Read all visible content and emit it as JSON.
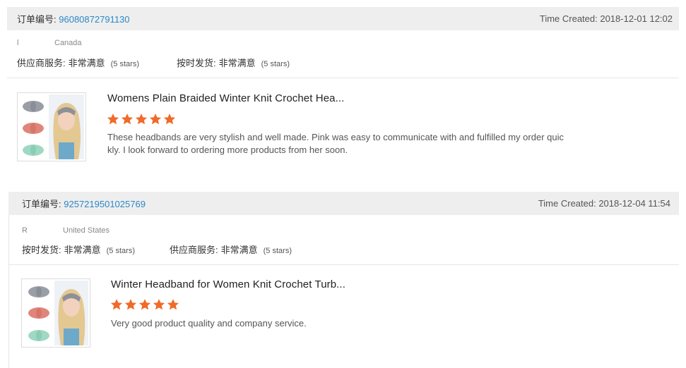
{
  "orders": [
    {
      "order_label": "订单编号:",
      "order_number": "96080872791130",
      "time_created": "Time Created: 2018-12-01 12:02",
      "buyer_initial": "l",
      "buyer_country": "Canada",
      "ratings": [
        {
          "label": "供应商服务:",
          "value": "非常满意",
          "stars_text": "(5 stars)"
        },
        {
          "label": "按时发货:",
          "value": "非常满意",
          "stars_text": "(5 stars)"
        }
      ],
      "product_title": "Womens Plain Braided Winter Knit Crochet Hea...",
      "star_rating": 5,
      "review": "These headbands are very stylish and well made. Pink was easy to communicate with and fulfilled my order quickly. I look forward to ordering more products from her soon."
    },
    {
      "order_label": "订单编号:",
      "order_number": "9257219501025769",
      "time_created": "Time Created: 2018-12-04 11:54",
      "buyer_initial": "R",
      "buyer_country": "United States",
      "ratings": [
        {
          "label": "按时发货:",
          "value": "非常满意",
          "stars_text": "(5 stars)"
        },
        {
          "label": "供应商服务:",
          "value": "非常满意",
          "stars_text": "(5 stars)"
        }
      ],
      "product_title": "Winter Headband for Women Knit Crochet Turb...",
      "star_rating": 5,
      "review": "Very good product quality and company service."
    }
  ],
  "colors": {
    "header_bg": "#eeeeee",
    "order_link": "#2b88c8",
    "star": "#f06a28"
  }
}
